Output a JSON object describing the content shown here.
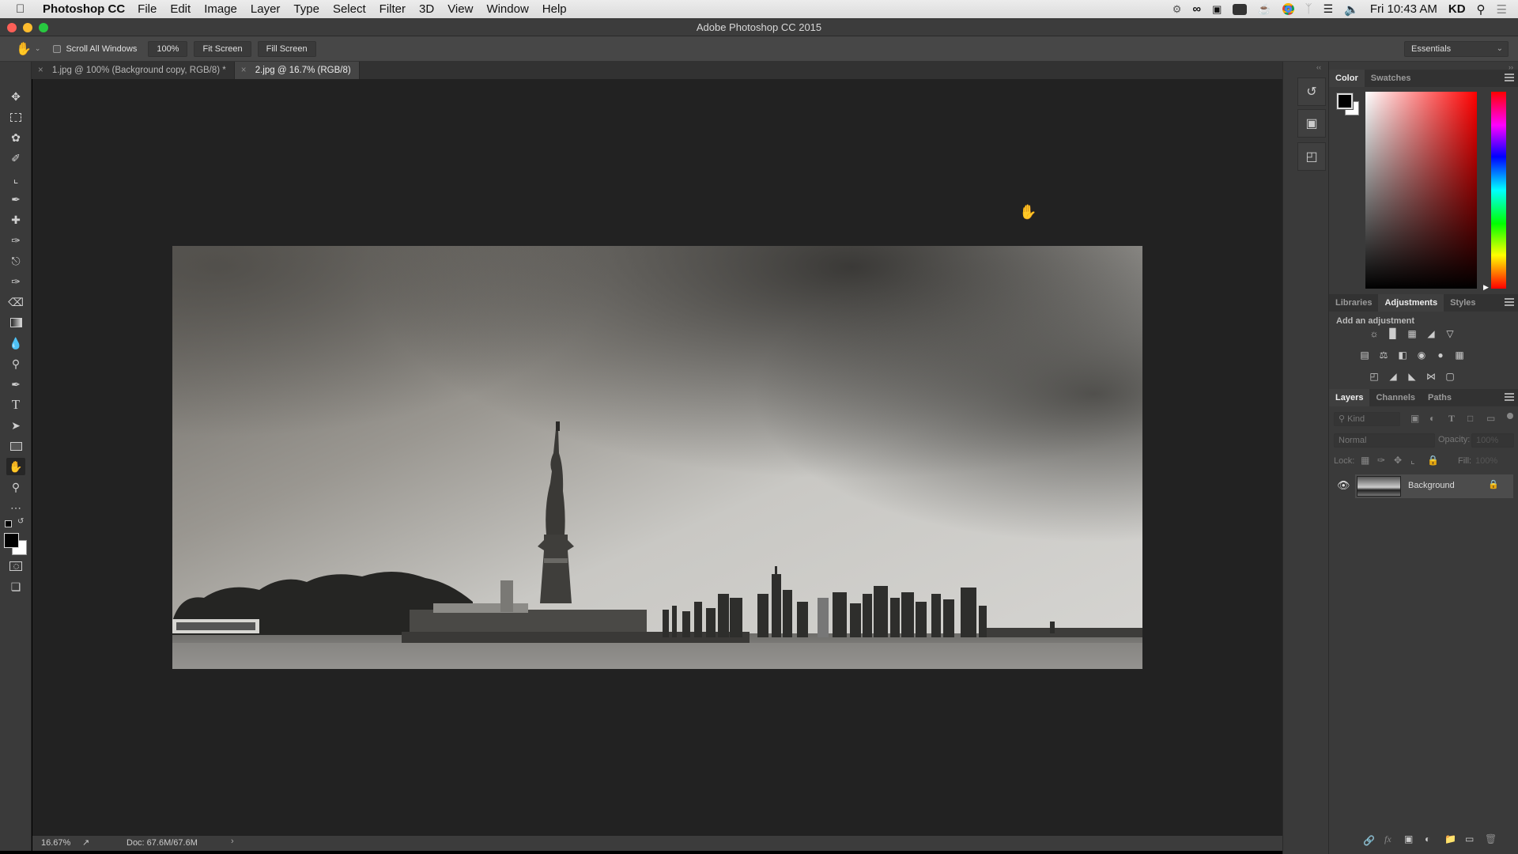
{
  "menubar": {
    "app_name": "Photoshop CC",
    "items": [
      "File",
      "Edit",
      "Image",
      "Layer",
      "Type",
      "Select",
      "Filter",
      "3D",
      "View",
      "Window",
      "Help"
    ],
    "clock": "Fri 10:43 AM",
    "user": "KD",
    "status_icons": [
      "sync-icon",
      "creative-cloud-icon",
      "camera-icon",
      "dropbox-icon",
      "coffee-icon",
      "chrome-icon",
      "bluetooth-icon",
      "wifi-icon",
      "volume-icon"
    ]
  },
  "window": {
    "title": "Adobe Photoshop CC 2015"
  },
  "options": {
    "tool_icon": "hand-icon",
    "scroll_all_windows_label": "Scroll All Windows",
    "scroll_all_windows_checked": false,
    "btn_100": "100%",
    "btn_fit": "Fit Screen",
    "btn_fill": "Fill Screen",
    "workspace": "Essentials"
  },
  "tabs": [
    {
      "label": "1.jpg @ 100% (Background copy, RGB/8) *",
      "active": false
    },
    {
      "label": "2.jpg @ 16.7% (RGB/8)",
      "active": true
    }
  ],
  "tools": [
    "move",
    "marquee",
    "lasso",
    "quick-selection",
    "crop",
    "eyedropper",
    "healing-brush",
    "brush",
    "clone-stamp",
    "history-brush",
    "eraser",
    "gradient",
    "blur",
    "dodge",
    "pen",
    "type",
    "path-selection",
    "rectangle",
    "hand",
    "zoom",
    "more",
    "default-colors",
    "swap-colors",
    "foreground-color",
    "background-color",
    "quick-mask",
    "screen-mode"
  ],
  "active_tool": "hand",
  "status": {
    "zoom": "16.67%",
    "doc": "Doc: 67.6M/67.6M"
  },
  "color_panel": {
    "tabs": [
      "Color",
      "Swatches"
    ],
    "active_tab": "Color",
    "foreground": "#000000",
    "background": "#ffffff",
    "hue_base": "#ff0000"
  },
  "adjustments_panel": {
    "tabs": [
      "Libraries",
      "Adjustments",
      "Styles"
    ],
    "active_tab": "Adjustments",
    "heading": "Add an adjustment",
    "rows": [
      [
        "brightness-contrast",
        "levels",
        "curves",
        "exposure",
        "vibrance"
      ],
      [
        "hue-saturation",
        "color-balance",
        "black-white",
        "photo-filter",
        "channel-mixer",
        "color-lookup"
      ],
      [
        "invert",
        "posterize",
        "threshold",
        "selective-color",
        "gradient-map"
      ]
    ]
  },
  "layers_panel": {
    "tabs": [
      "Layers",
      "Channels",
      "Paths"
    ],
    "active_tab": "Layers",
    "filter_placeholder": "Kind",
    "blend_mode": "Normal",
    "opacity_label": "Opacity:",
    "opacity_value": "100%",
    "lock_label": "Lock:",
    "fill_label": "Fill:",
    "fill_value": "100%",
    "layers": [
      {
        "name": "Background",
        "visible": true,
        "locked": true
      }
    ],
    "footer_icons": [
      "link-icon",
      "fx-icon",
      "mask-icon",
      "adjustment-icon",
      "folder-icon",
      "new-layer-icon",
      "trash-icon"
    ]
  }
}
